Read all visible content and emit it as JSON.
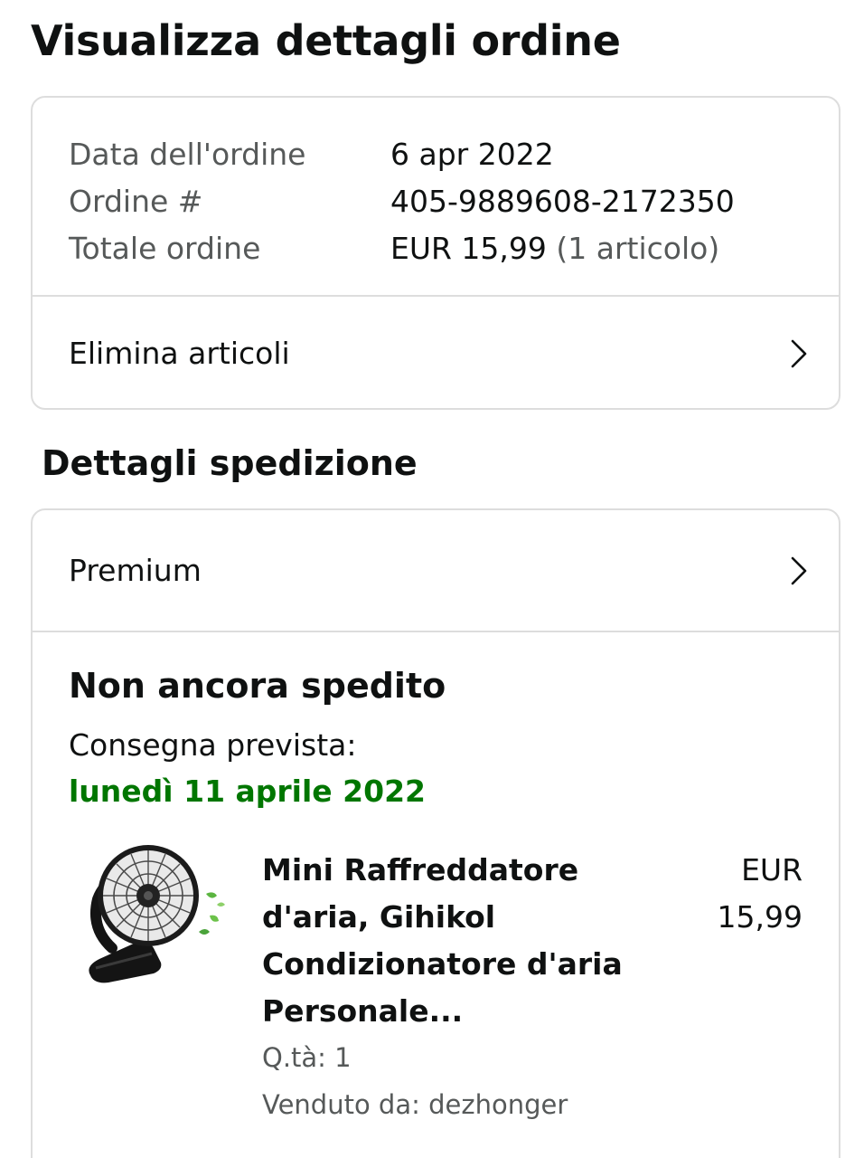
{
  "page": {
    "title": "Visualizza dettagli ordine"
  },
  "order": {
    "date_label": "Data dell'ordine",
    "date_value": "6 apr 2022",
    "number_label": "Ordine #",
    "number_value": "405-9889608-2172350",
    "total_label": "Totale ordine",
    "total_value": "EUR 15,99",
    "total_note": "(1 articolo)"
  },
  "actions": {
    "delete_items": "Elimina articoli"
  },
  "shipping": {
    "section_title": "Dettagli spedizione",
    "method": "Premium",
    "status": "Non ancora spedito",
    "delivery_label": "Consegna prevista:",
    "delivery_date": "lunedì 11 aprile 2022",
    "delivery_date_color": "#007600"
  },
  "item": {
    "title_line1": "Mini Raffreddatore",
    "title_line2": "d'aria, Gihikol",
    "title_line3": "Condizionatore d'aria",
    "title_line4": "Personale...",
    "price_line1": "EUR",
    "price_line2": "15,99",
    "quantity": "Q.tà: 1",
    "seller": "Venduto da: dezhonger",
    "image_icon": "clip-desk-fan-image"
  },
  "icons": {
    "chevron": "chevron-right-icon"
  }
}
